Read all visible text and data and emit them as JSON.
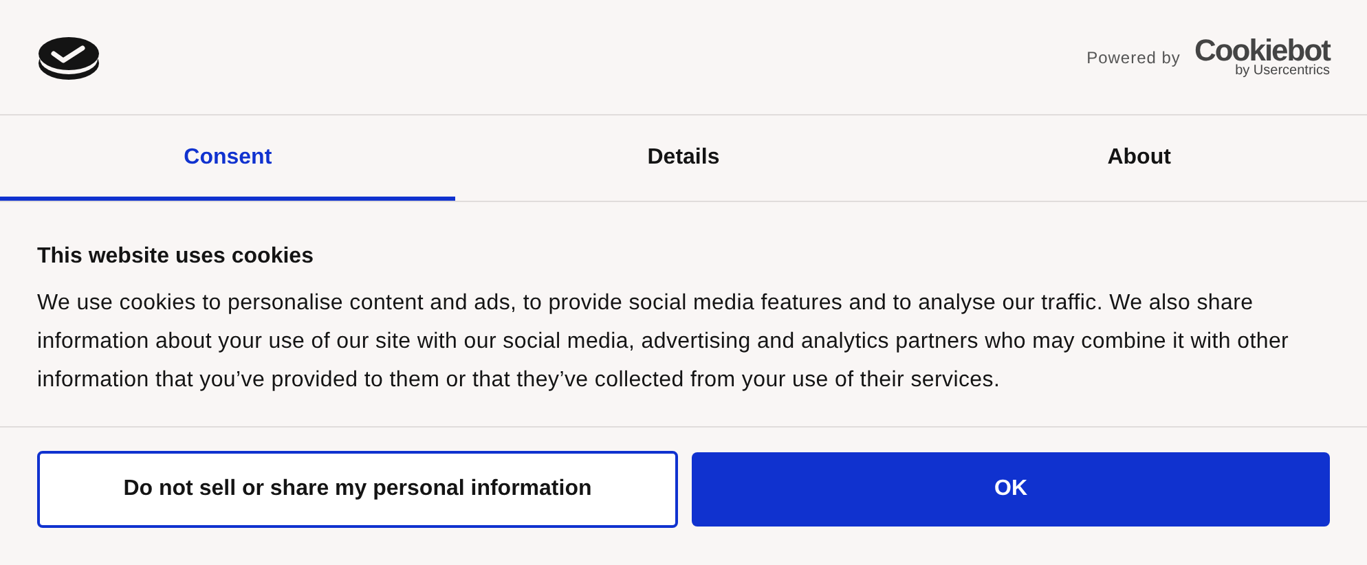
{
  "header": {
    "powered_by": "Powered by",
    "brand": "Cookiebot",
    "brand_sub": "by Usercentrics"
  },
  "tabs": [
    {
      "label": "Consent",
      "selected": true
    },
    {
      "label": "Details",
      "selected": false
    },
    {
      "label": "About",
      "selected": false
    }
  ],
  "content": {
    "title": "This website uses cookies",
    "body": "We use cookies to personalise content and ads, to provide social media features and to analyse our traffic. We also share information about your use of our site with our social media, advertising and analytics partners who may combine it with other information that you’ve provided to them or that they’ve collected from your use of their services."
  },
  "buttons": [
    {
      "label": "Do not sell or share my personal information",
      "kind": "outline"
    },
    {
      "label": "OK",
      "kind": "primary"
    }
  ]
}
